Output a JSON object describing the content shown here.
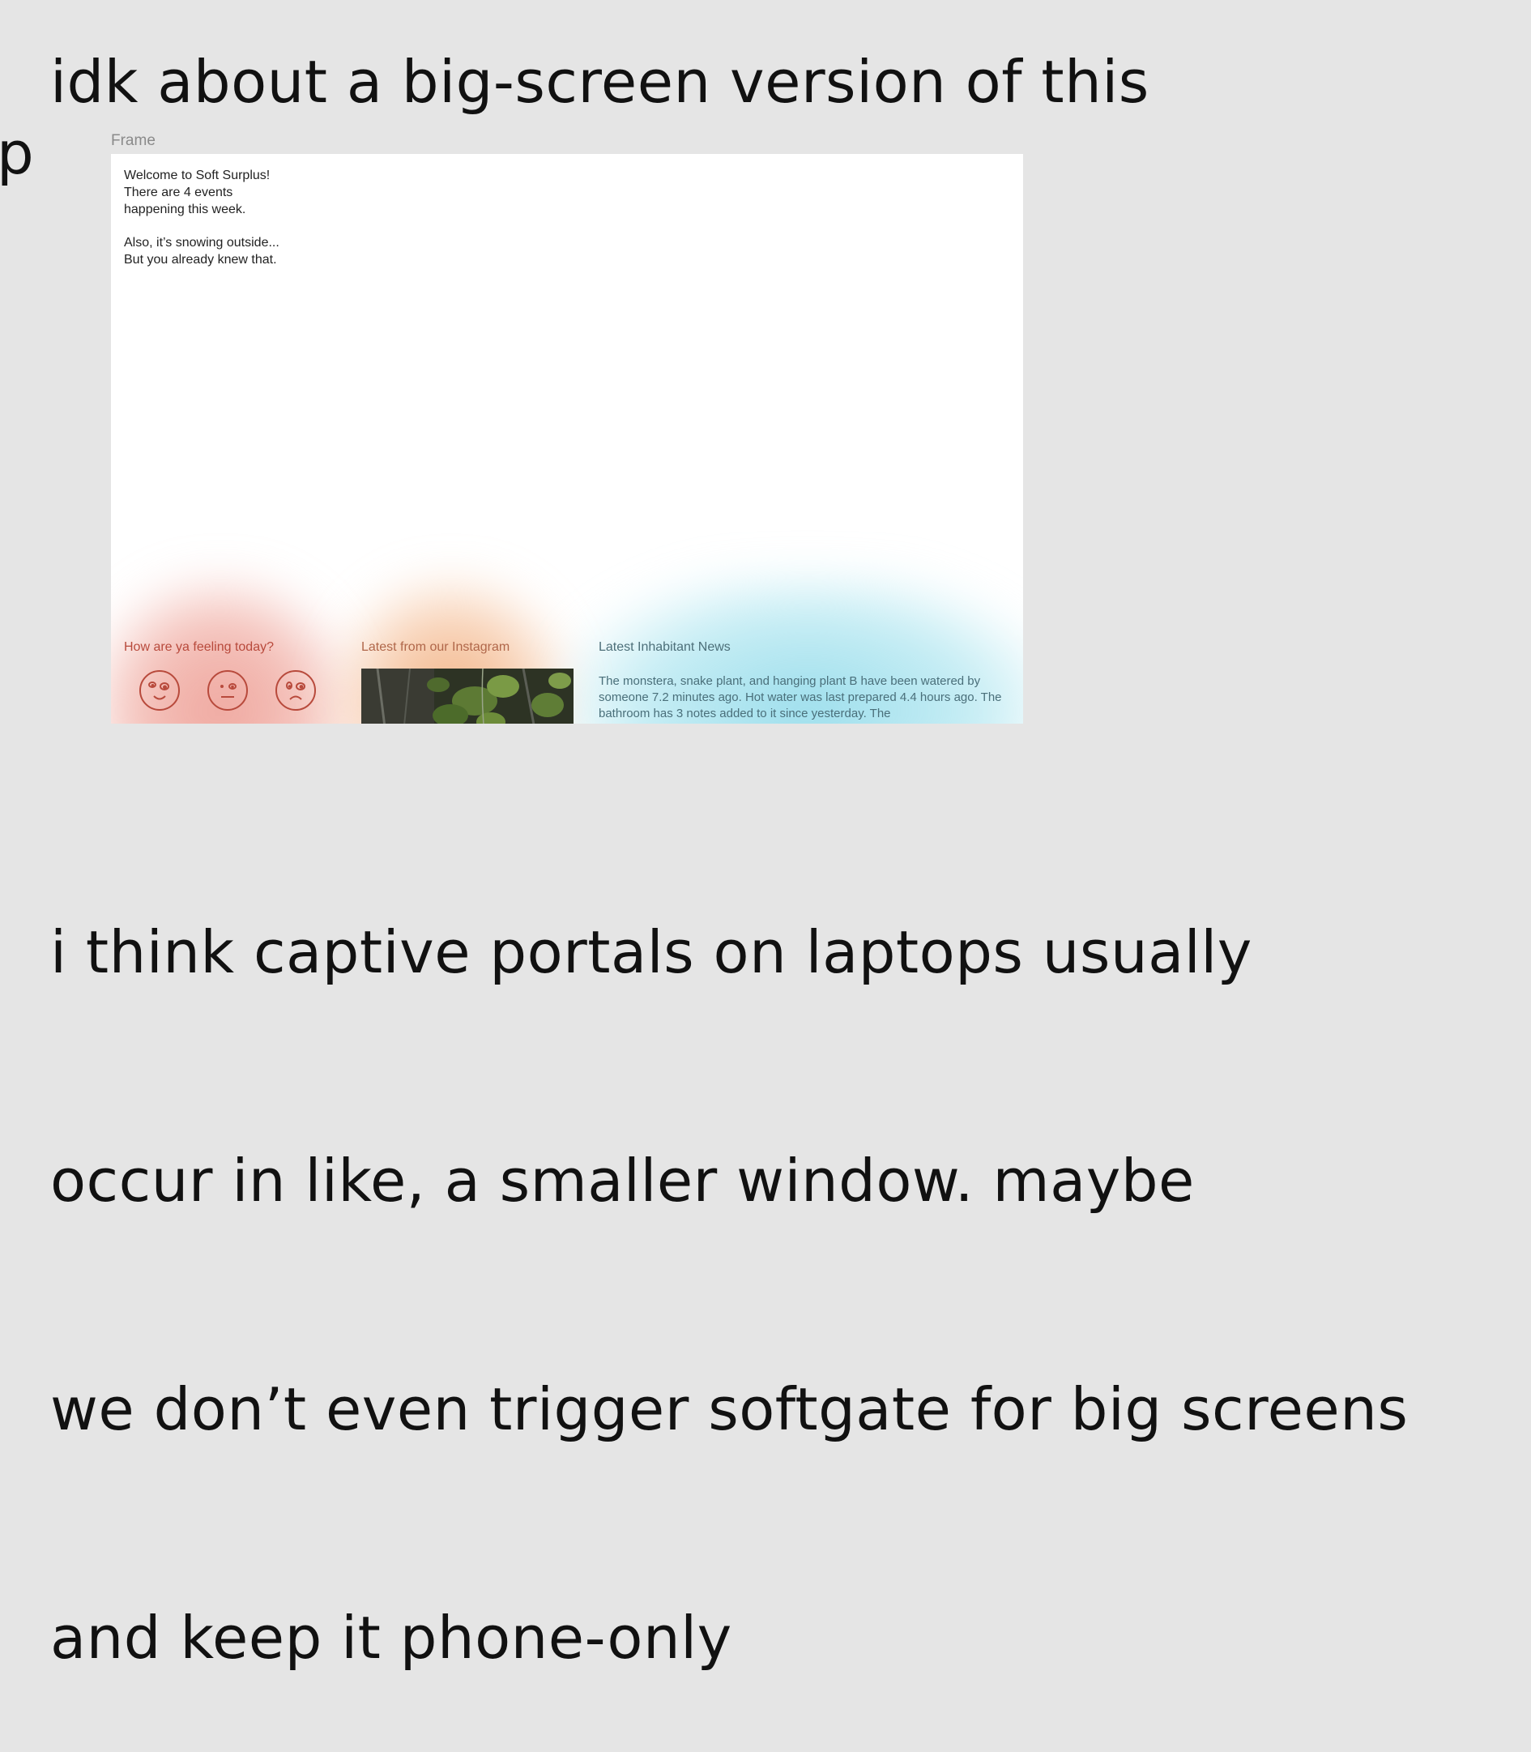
{
  "canvas": {
    "note_top": "idk about a big-screen version of this",
    "note_clipped": "op",
    "note_bottom": [
      "i think captive portals on laptops usually",
      "occur in like, a smaller window. maybe",
      "we don’t even trigger softgate for big screens",
      "and keep it phone-only"
    ]
  },
  "frame": {
    "label": "Frame",
    "welcome_lines": [
      "Welcome to Soft Surplus!",
      "There are 4 events",
      "happening this week."
    ],
    "snow_lines": [
      "Also, it’s snowing outside...",
      "But you already knew that."
    ],
    "mood_panel": {
      "title": "How are ya feeling today?",
      "faces": [
        "happy-face-icon",
        "neutral-face-icon",
        "sad-face-icon"
      ],
      "color": "#b84a3c"
    },
    "instagram_panel": {
      "title": "Latest from our Instagram",
      "image": "plant-leaves-photo"
    },
    "news_panel": {
      "title": "Latest Inhabitant News",
      "body": "The monstera, snake plant, and hanging plant B have been watered by someone 7.2 minutes ago. Hot water was last prepared 4.4 hours ago. The bathroom has 3 notes added to it since yesterday. The"
    }
  }
}
